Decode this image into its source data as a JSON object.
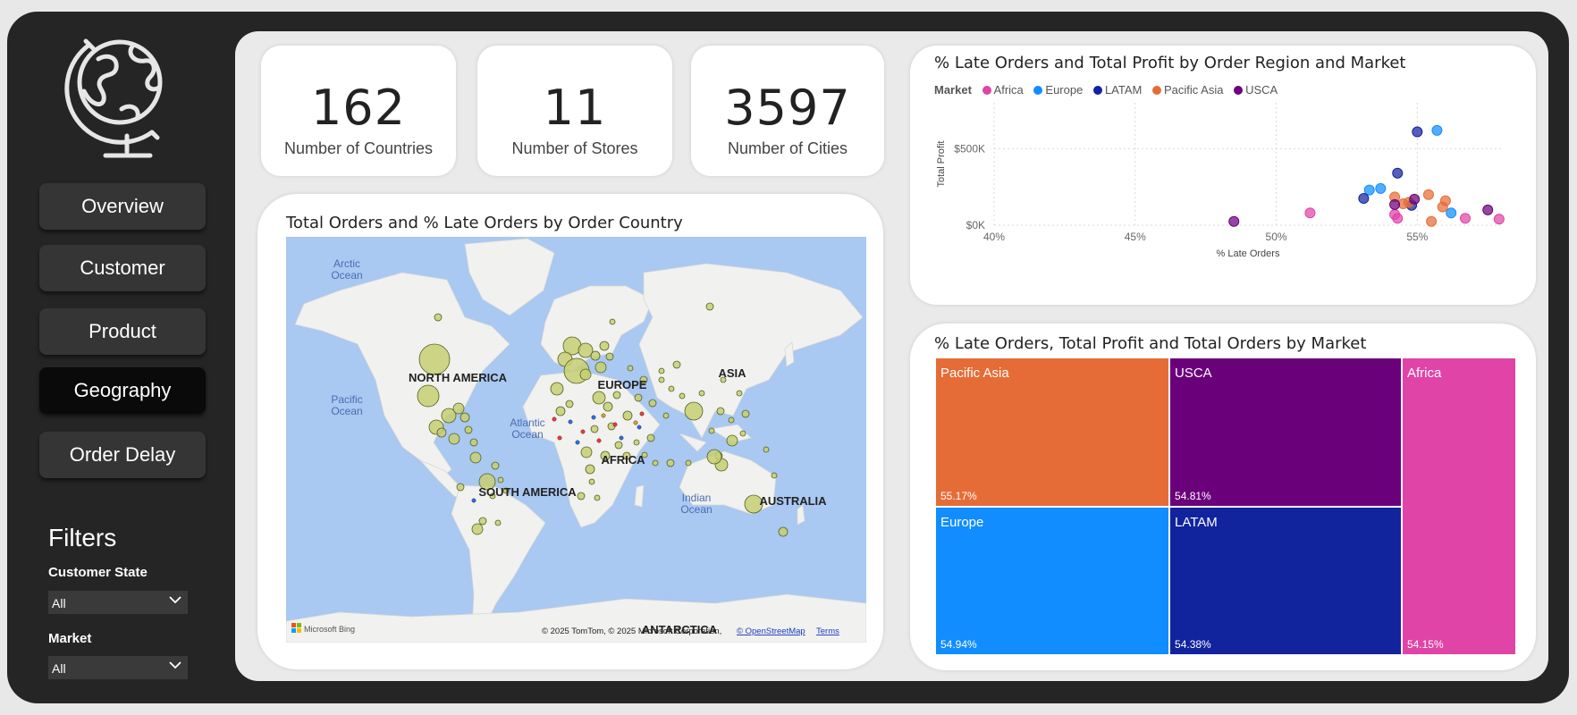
{
  "sidebar": {
    "nav": [
      {
        "label": "Overview",
        "active": false
      },
      {
        "label": "Customer",
        "active": false
      },
      {
        "label": "Product",
        "active": false
      },
      {
        "label": "Geography",
        "active": true
      },
      {
        "label": "Order Delay",
        "active": false
      }
    ],
    "filters_title": "Filters",
    "filters": [
      {
        "label": "Customer State",
        "value": "All"
      },
      {
        "label": "Market",
        "value": "All"
      }
    ],
    "logo_icon": "globe-icon"
  },
  "kpis": [
    {
      "value": "162",
      "label": "Number of Countries"
    },
    {
      "value": "11",
      "label": "Number of Stores"
    },
    {
      "value": "3597",
      "label": "Number of Cities"
    }
  ],
  "map": {
    "title": "Total Orders and % Late Orders by Order Country",
    "ocean_labels": {
      "arctic": [
        "Arctic",
        "Ocean"
      ],
      "pacific": [
        "Pacific",
        "Ocean"
      ],
      "atlantic": [
        "Atlantic",
        "Ocean"
      ],
      "indian": [
        "Indian",
        "Ocean"
      ]
    },
    "continent_labels": {
      "north_america": "NORTH AMERICA",
      "south_america": "SOUTH AMERICA",
      "europe": "EUROPE",
      "africa": "AFRICA",
      "asia": "ASIA",
      "australia": "AUSTRALIA",
      "antarctica": "ANTARCTICA"
    },
    "attribution": "© 2025 TomTom, © 2025 Microsoft Corporation,",
    "osm_link": "© OpenStreetMap",
    "terms_link": "Terms",
    "provider": "Microsoft Bing",
    "colors": {
      "water": "#a9c8f2",
      "land": "#f1f1ef",
      "bubble": "#c7cf72"
    }
  },
  "scatter": {
    "title": "% Late Orders and Total Profit by Order Region and Market",
    "legend_title": "Market",
    "legend": [
      {
        "name": "Africa",
        "color": "#e044a7"
      },
      {
        "name": "Europe",
        "color": "#118dff"
      },
      {
        "name": "LATAM",
        "color": "#12239e"
      },
      {
        "name": "Pacific Asia",
        "color": "#e66c37"
      },
      {
        "name": "USCA",
        "color": "#6b007b"
      }
    ]
  },
  "chart_data": [
    {
      "type": "scatter",
      "title": "% Late Orders and Total Profit by Order Region and Market",
      "xlabel": "% Late Orders",
      "ylabel": "Total Profit",
      "xlim": [
        40,
        58
      ],
      "ylim": [
        0,
        800000
      ],
      "x_ticks": [
        "40%",
        "45%",
        "50%",
        "55%"
      ],
      "y_ticks": [
        "$0K",
        "$500K"
      ],
      "grid": true,
      "legend_position": "top-left",
      "series": [
        {
          "name": "Africa",
          "color": "#e044a7",
          "points": [
            [
              51.2,
              80000
            ],
            [
              54.2,
              70000
            ],
            [
              54.3,
              45000
            ],
            [
              56.7,
              45000
            ],
            [
              57.9,
              40000
            ]
          ]
        },
        {
          "name": "Europe",
          "color": "#118dff",
          "points": [
            [
              53.3,
              230000
            ],
            [
              53.7,
              240000
            ],
            [
              55.7,
              620000
            ],
            [
              56.2,
              80000
            ]
          ]
        },
        {
          "name": "LATAM",
          "color": "#12239e",
          "points": [
            [
              53.1,
              175000
            ],
            [
              54.3,
              340000
            ],
            [
              54.8,
              130000
            ],
            [
              55.0,
              610000
            ]
          ]
        },
        {
          "name": "Pacific Asia",
          "color": "#e66c37",
          "points": [
            [
              54.2,
              185000
            ],
            [
              54.5,
              140000
            ],
            [
              54.7,
              150000
            ],
            [
              55.4,
              200000
            ],
            [
              55.9,
              120000
            ],
            [
              56.0,
              160000
            ],
            [
              55.5,
              25000
            ]
          ]
        },
        {
          "name": "USCA",
          "color": "#6b007b",
          "points": [
            [
              48.5,
              25000
            ],
            [
              54.2,
              135000
            ],
            [
              54.9,
              170000
            ],
            [
              57.5,
              100000
            ]
          ]
        }
      ]
    },
    {
      "type": "treemap",
      "title": "% Late Orders, Total Profit and Total Orders by Market",
      "categories": [
        "Pacific Asia",
        "USCA",
        "Africa",
        "Europe",
        "LATAM"
      ],
      "labels": [
        "55.17%",
        "54.81%",
        "54.15%",
        "54.94%",
        "54.38%"
      ],
      "values": [
        55.17,
        54.81,
        54.15,
        54.94,
        54.38
      ],
      "colors": [
        "#e66c37",
        "#6b007b",
        "#e044a7",
        "#118dff",
        "#12239e"
      ]
    }
  ]
}
